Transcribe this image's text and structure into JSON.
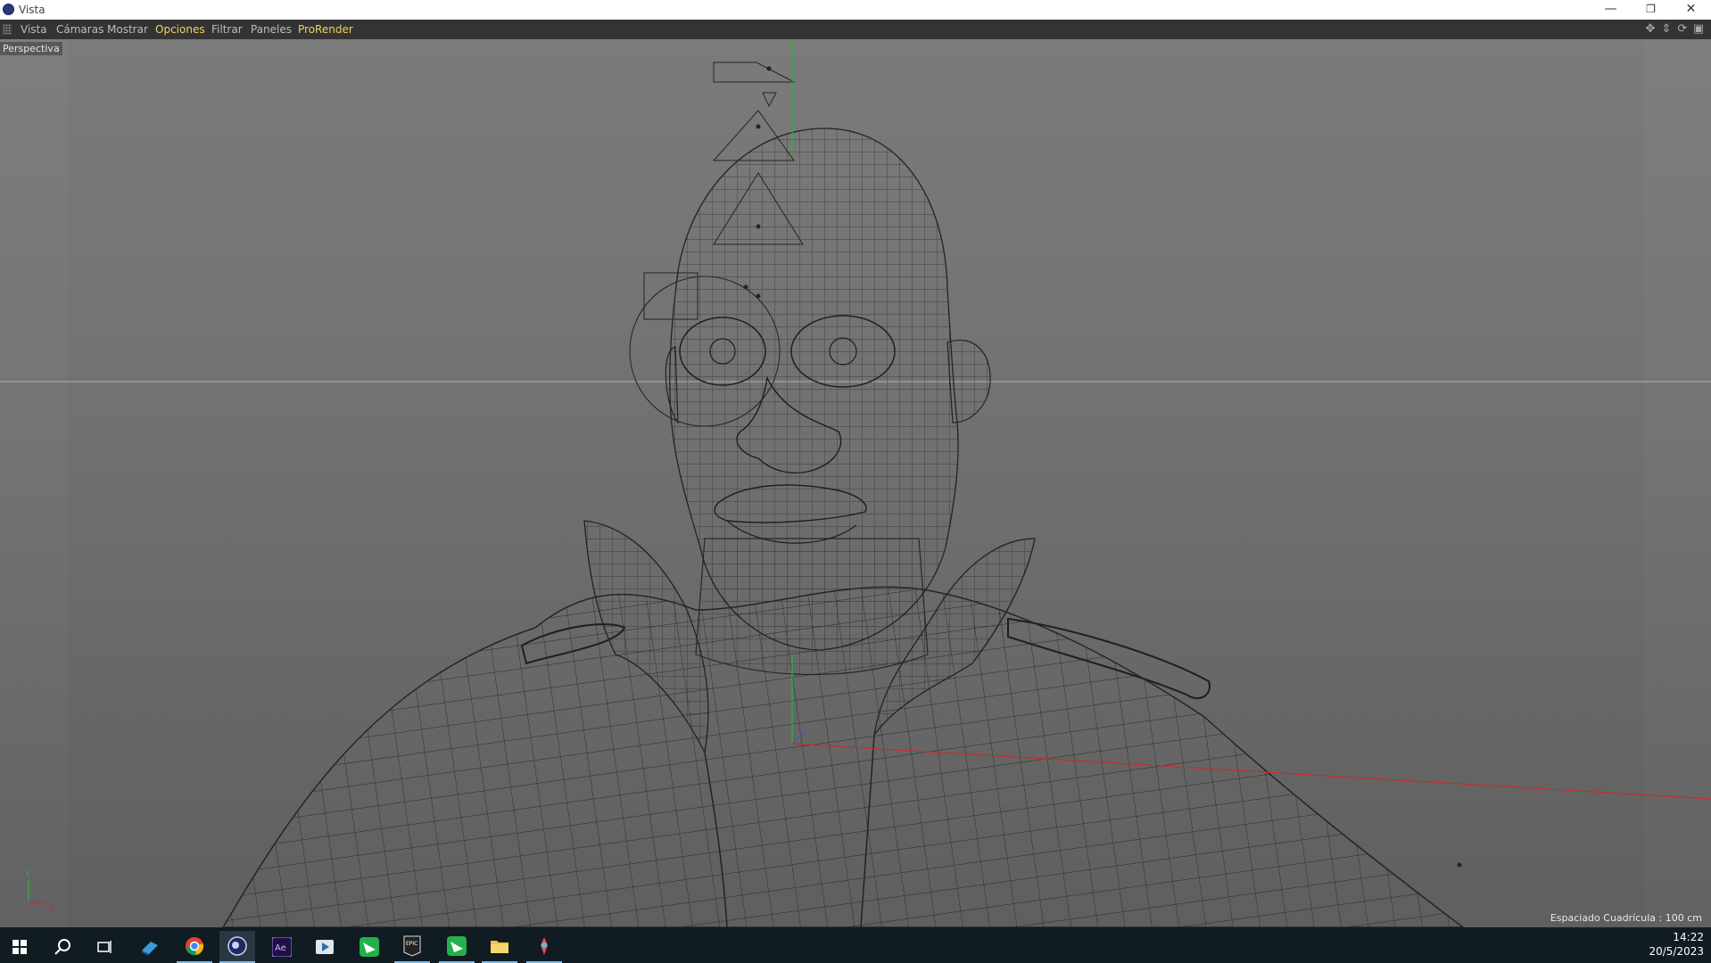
{
  "window": {
    "title": "Vista",
    "controls": {
      "minimize": "—",
      "restore": "❐",
      "close": "✕"
    }
  },
  "menu": {
    "items": [
      {
        "label": "Vista",
        "highlight": false
      },
      {
        "label": "Cámaras",
        "highlight": false
      },
      {
        "label": "Mostrar",
        "highlight": false
      },
      {
        "label": "Opciones",
        "highlight": true
      },
      {
        "label": "Filtrar",
        "highlight": false
      },
      {
        "label": "Paneles",
        "highlight": false
      },
      {
        "label": "ProRender",
        "highlight": true
      }
    ],
    "nav_icons": [
      "move-view-icon",
      "zoom-view-icon",
      "rotate-view-icon",
      "maximize-view-icon"
    ]
  },
  "viewport": {
    "camera": "Perspectiva",
    "grid_spacing": "Espaciado Cuadrícula : 100 cm",
    "axis": {
      "y": "Y",
      "x": "X"
    }
  },
  "taskbar": {
    "icons": [
      "windows-start-icon",
      "search-icon",
      "task-view-icon",
      "app-icon",
      "chrome-icon",
      "cinema4d-icon",
      "after-effects-icon",
      "media-player-icon",
      "green-app-icon",
      "epic-games-icon",
      "green-app-icon-2",
      "file-explorer-icon",
      "paint-icon"
    ],
    "clock": {
      "time": "14:22",
      "date": "20/5/2023"
    }
  },
  "colors": {
    "highlight_menu": "#f0d060",
    "taskbar": "#101b22",
    "menubar": "#333333"
  }
}
